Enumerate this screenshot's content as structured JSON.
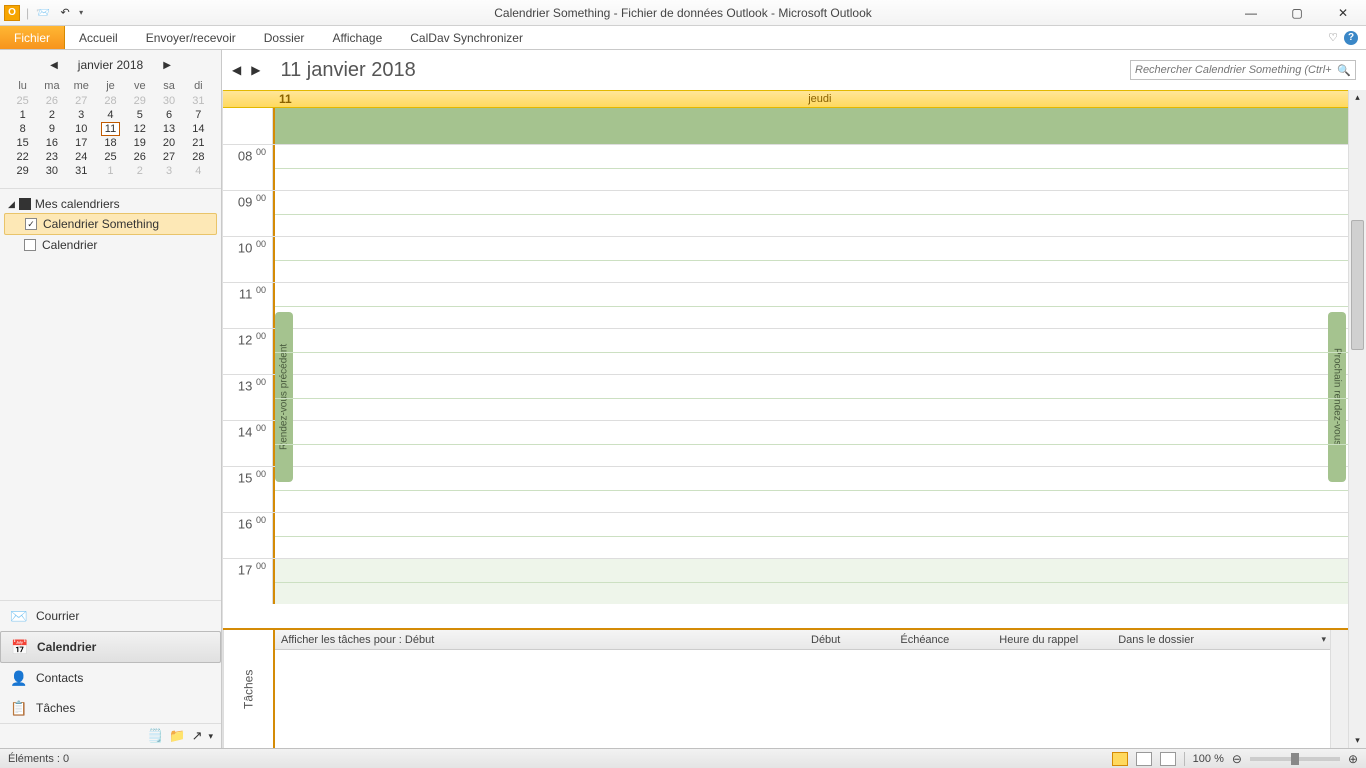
{
  "window": {
    "title": "Calendrier Something - Fichier de données Outlook  -  Microsoft Outlook"
  },
  "qat": {
    "icon_letter": "O"
  },
  "ribbon": {
    "tabs": {
      "file": "Fichier",
      "home": "Accueil",
      "sendreceive": "Envoyer/recevoir",
      "folder": "Dossier",
      "view": "Affichage",
      "caldav": "CalDav Synchronizer"
    }
  },
  "minical": {
    "month": "janvier 2018",
    "days": [
      "lu",
      "ma",
      "me",
      "je",
      "ve",
      "sa",
      "di"
    ],
    "weeks": [
      [
        {
          "d": "25",
          "o": true
        },
        {
          "d": "26",
          "o": true
        },
        {
          "d": "27",
          "o": true
        },
        {
          "d": "28",
          "o": true
        },
        {
          "d": "29",
          "o": true
        },
        {
          "d": "30",
          "o": true
        },
        {
          "d": "31",
          "o": true
        }
      ],
      [
        {
          "d": "1"
        },
        {
          "d": "2"
        },
        {
          "d": "3"
        },
        {
          "d": "4"
        },
        {
          "d": "5"
        },
        {
          "d": "6"
        },
        {
          "d": "7"
        }
      ],
      [
        {
          "d": "8"
        },
        {
          "d": "9"
        },
        {
          "d": "10"
        },
        {
          "d": "11",
          "today": true
        },
        {
          "d": "12"
        },
        {
          "d": "13"
        },
        {
          "d": "14"
        }
      ],
      [
        {
          "d": "15"
        },
        {
          "d": "16"
        },
        {
          "d": "17"
        },
        {
          "d": "18"
        },
        {
          "d": "19"
        },
        {
          "d": "20"
        },
        {
          "d": "21"
        }
      ],
      [
        {
          "d": "22"
        },
        {
          "d": "23"
        },
        {
          "d": "24"
        },
        {
          "d": "25"
        },
        {
          "d": "26"
        },
        {
          "d": "27"
        },
        {
          "d": "28"
        }
      ],
      [
        {
          "d": "29"
        },
        {
          "d": "30"
        },
        {
          "d": "31"
        },
        {
          "d": "1",
          "o": true
        },
        {
          "d": "2",
          "o": true
        },
        {
          "d": "3",
          "o": true
        },
        {
          "d": "4",
          "o": true
        }
      ]
    ]
  },
  "caltree": {
    "group": "Mes calendriers",
    "items": [
      {
        "label": "Calendrier Something",
        "checked": true,
        "selected": true
      },
      {
        "label": "Calendrier",
        "checked": false,
        "selected": false
      }
    ]
  },
  "nav": {
    "mail": "Courrier",
    "calendar": "Calendrier",
    "contacts": "Contacts",
    "tasks": "Tâches"
  },
  "calview": {
    "date_label": "11 janvier 2018",
    "day_number": "11",
    "day_name": "jeudi",
    "search_placeholder": "Rechercher Calendrier Something (Ctrl+",
    "hours": [
      "08",
      "09",
      "10",
      "11",
      "12",
      "13",
      "14",
      "15",
      "16",
      "17"
    ],
    "minute": "00",
    "prev_appt": "Rendez-vous précédent",
    "next_appt": "Prochain rendez-vous"
  },
  "tasks_panel": {
    "label": "Tâches",
    "header_text": "Afficher les tâches pour : Début",
    "cols": {
      "debut": "Début",
      "echeance": "Échéance",
      "rappel": "Heure du rappel",
      "dossier": "Dans le dossier"
    }
  },
  "statusbar": {
    "items": "Éléments : 0",
    "zoom": "100 %"
  }
}
